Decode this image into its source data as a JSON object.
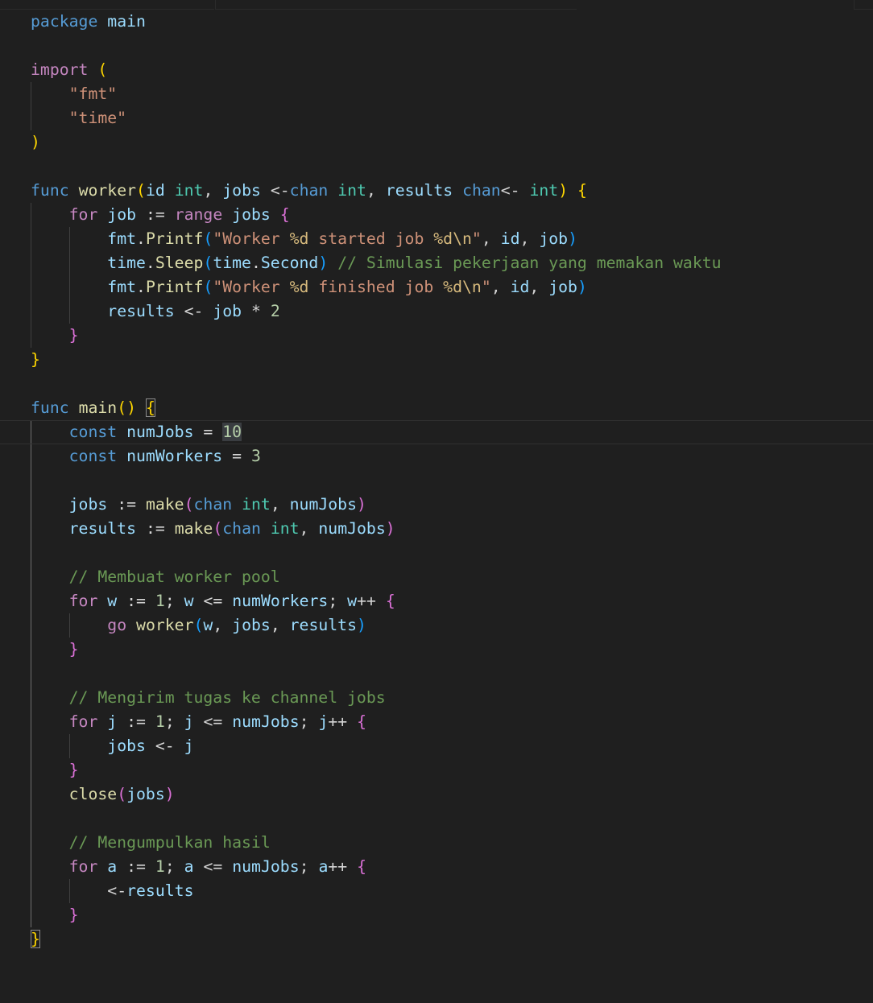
{
  "colors": {
    "background": "#1f1f1f",
    "keyword_blue": "#569cd6",
    "keyword_control": "#c586c0",
    "function": "#dcdcaa",
    "type": "#4ec9b0",
    "variable": "#9cdcfe",
    "string": "#ce9178",
    "escape": "#d7ba7d",
    "number": "#b5cea8",
    "comment": "#6a9955",
    "bracket_gold": "#ffd700",
    "bracket_purple": "#da70d6",
    "bracket_blue": "#179fff",
    "plain": "#d4d4d4"
  },
  "code_lines": [
    [
      [
        "package",
        "kw"
      ],
      [
        " ",
        "p"
      ],
      [
        "main",
        "plain"
      ]
    ],
    [],
    [
      [
        "import",
        "ctl"
      ],
      [
        " ",
        "p"
      ],
      [
        "(",
        "b1"
      ]
    ],
    [
      [
        "    ",
        "p"
      ],
      [
        "\"fmt\"",
        "str"
      ]
    ],
    [
      [
        "    ",
        "p"
      ],
      [
        "\"time\"",
        "str"
      ]
    ],
    [
      [
        ")",
        "b1"
      ]
    ],
    [],
    [
      [
        "func",
        "kw"
      ],
      [
        " ",
        "p"
      ],
      [
        "worker",
        "fn"
      ],
      [
        "(",
        "b1"
      ],
      [
        "id",
        "var"
      ],
      [
        " ",
        "p"
      ],
      [
        "int",
        "type"
      ],
      [
        ", ",
        "p"
      ],
      [
        "jobs",
        "var"
      ],
      [
        " ",
        "p"
      ],
      [
        "<-",
        "op"
      ],
      [
        "chan",
        "kw"
      ],
      [
        " ",
        "p"
      ],
      [
        "int",
        "type"
      ],
      [
        ", ",
        "p"
      ],
      [
        "results",
        "var"
      ],
      [
        " ",
        "p"
      ],
      [
        "chan",
        "kw"
      ],
      [
        "<-",
        "op"
      ],
      [
        " ",
        "p"
      ],
      [
        "int",
        "type"
      ],
      [
        ")",
        "b1"
      ],
      [
        " ",
        "p"
      ],
      [
        "{",
        "b1"
      ]
    ],
    [
      [
        "    ",
        "p"
      ],
      [
        "for",
        "ctl"
      ],
      [
        " ",
        "p"
      ],
      [
        "job",
        "var"
      ],
      [
        " ",
        "p"
      ],
      [
        ":=",
        "op"
      ],
      [
        " ",
        "p"
      ],
      [
        "range",
        "ctl"
      ],
      [
        " ",
        "p"
      ],
      [
        "jobs",
        "var"
      ],
      [
        " ",
        "p"
      ],
      [
        "{",
        "b2"
      ]
    ],
    [
      [
        "        ",
        "p"
      ],
      [
        "fmt",
        "var"
      ],
      [
        ".",
        "p"
      ],
      [
        "Printf",
        "fn"
      ],
      [
        "(",
        "b3"
      ],
      [
        "\"Worker ",
        "str"
      ],
      [
        "%d",
        "esc"
      ],
      [
        " started job ",
        "str"
      ],
      [
        "%d",
        "esc"
      ],
      [
        "\\n",
        "esc"
      ],
      [
        "\"",
        "str"
      ],
      [
        ", ",
        "p"
      ],
      [
        "id",
        "var"
      ],
      [
        ", ",
        "p"
      ],
      [
        "job",
        "var"
      ],
      [
        ")",
        "b3"
      ]
    ],
    [
      [
        "        ",
        "p"
      ],
      [
        "time",
        "var"
      ],
      [
        ".",
        "p"
      ],
      [
        "Sleep",
        "fn"
      ],
      [
        "(",
        "b3"
      ],
      [
        "time",
        "var"
      ],
      [
        ".",
        "p"
      ],
      [
        "Second",
        "var"
      ],
      [
        ")",
        "b3"
      ],
      [
        " ",
        "p"
      ],
      [
        "// Simulasi pekerjaan yang memakan waktu",
        "cmt"
      ]
    ],
    [
      [
        "        ",
        "p"
      ],
      [
        "fmt",
        "var"
      ],
      [
        ".",
        "p"
      ],
      [
        "Printf",
        "fn"
      ],
      [
        "(",
        "b3"
      ],
      [
        "\"Worker ",
        "str"
      ],
      [
        "%d",
        "esc"
      ],
      [
        " finished job ",
        "str"
      ],
      [
        "%d",
        "esc"
      ],
      [
        "\\n",
        "esc"
      ],
      [
        "\"",
        "str"
      ],
      [
        ", ",
        "p"
      ],
      [
        "id",
        "var"
      ],
      [
        ", ",
        "p"
      ],
      [
        "job",
        "var"
      ],
      [
        ")",
        "b3"
      ]
    ],
    [
      [
        "        ",
        "p"
      ],
      [
        "results",
        "var"
      ],
      [
        " ",
        "p"
      ],
      [
        "<-",
        "op"
      ],
      [
        " ",
        "p"
      ],
      [
        "job",
        "var"
      ],
      [
        " ",
        "p"
      ],
      [
        "*",
        "op"
      ],
      [
        " ",
        "p"
      ],
      [
        "2",
        "num"
      ]
    ],
    [
      [
        "    ",
        "p"
      ],
      [
        "}",
        "b2"
      ]
    ],
    [
      [
        "}",
        "b1"
      ]
    ],
    [],
    [
      [
        "func",
        "kw"
      ],
      [
        " ",
        "p"
      ],
      [
        "main",
        "fn"
      ],
      [
        "()",
        "b1"
      ],
      [
        " ",
        "p"
      ],
      [
        "{",
        "b1bm"
      ]
    ],
    [
      [
        "    ",
        "p"
      ],
      [
        "const",
        "kw"
      ],
      [
        " ",
        "p"
      ],
      [
        "numJobs",
        "var"
      ],
      [
        " ",
        "p"
      ],
      [
        "=",
        "op"
      ],
      [
        " ",
        "p"
      ],
      [
        "10",
        "numsel"
      ]
    ],
    [
      [
        "    ",
        "p"
      ],
      [
        "const",
        "kw"
      ],
      [
        " ",
        "p"
      ],
      [
        "numWorkers",
        "var"
      ],
      [
        " ",
        "p"
      ],
      [
        "=",
        "op"
      ],
      [
        " ",
        "p"
      ],
      [
        "3",
        "num"
      ]
    ],
    [],
    [
      [
        "    ",
        "p"
      ],
      [
        "jobs",
        "var"
      ],
      [
        " ",
        "p"
      ],
      [
        ":=",
        "op"
      ],
      [
        " ",
        "p"
      ],
      [
        "make",
        "fn"
      ],
      [
        "(",
        "b2"
      ],
      [
        "chan",
        "kw"
      ],
      [
        " ",
        "p"
      ],
      [
        "int",
        "type"
      ],
      [
        ", ",
        "p"
      ],
      [
        "numJobs",
        "var"
      ],
      [
        ")",
        "b2"
      ]
    ],
    [
      [
        "    ",
        "p"
      ],
      [
        "results",
        "var"
      ],
      [
        " ",
        "p"
      ],
      [
        ":=",
        "op"
      ],
      [
        " ",
        "p"
      ],
      [
        "make",
        "fn"
      ],
      [
        "(",
        "b2"
      ],
      [
        "chan",
        "kw"
      ],
      [
        " ",
        "p"
      ],
      [
        "int",
        "type"
      ],
      [
        ", ",
        "p"
      ],
      [
        "numJobs",
        "var"
      ],
      [
        ")",
        "b2"
      ]
    ],
    [],
    [
      [
        "    ",
        "p"
      ],
      [
        "// Membuat worker pool",
        "cmt"
      ]
    ],
    [
      [
        "    ",
        "p"
      ],
      [
        "for",
        "ctl"
      ],
      [
        " ",
        "p"
      ],
      [
        "w",
        "var"
      ],
      [
        " ",
        "p"
      ],
      [
        ":=",
        "op"
      ],
      [
        " ",
        "p"
      ],
      [
        "1",
        "num"
      ],
      [
        "; ",
        "p"
      ],
      [
        "w",
        "var"
      ],
      [
        " ",
        "p"
      ],
      [
        "<=",
        "op"
      ],
      [
        " ",
        "p"
      ],
      [
        "numWorkers",
        "var"
      ],
      [
        "; ",
        "p"
      ],
      [
        "w",
        "var"
      ],
      [
        "++",
        "op"
      ],
      [
        " ",
        "p"
      ],
      [
        "{",
        "b2"
      ]
    ],
    [
      [
        "        ",
        "p"
      ],
      [
        "go",
        "ctl"
      ],
      [
        " ",
        "p"
      ],
      [
        "worker",
        "fn"
      ],
      [
        "(",
        "b3"
      ],
      [
        "w",
        "var"
      ],
      [
        ", ",
        "p"
      ],
      [
        "jobs",
        "var"
      ],
      [
        ", ",
        "p"
      ],
      [
        "results",
        "var"
      ],
      [
        ")",
        "b3"
      ]
    ],
    [
      [
        "    ",
        "p"
      ],
      [
        "}",
        "b2"
      ]
    ],
    [],
    [
      [
        "    ",
        "p"
      ],
      [
        "// Mengirim tugas ke channel jobs",
        "cmt"
      ]
    ],
    [
      [
        "    ",
        "p"
      ],
      [
        "for",
        "ctl"
      ],
      [
        " ",
        "p"
      ],
      [
        "j",
        "var"
      ],
      [
        " ",
        "p"
      ],
      [
        ":=",
        "op"
      ],
      [
        " ",
        "p"
      ],
      [
        "1",
        "num"
      ],
      [
        "; ",
        "p"
      ],
      [
        "j",
        "var"
      ],
      [
        " ",
        "p"
      ],
      [
        "<=",
        "op"
      ],
      [
        " ",
        "p"
      ],
      [
        "numJobs",
        "var"
      ],
      [
        "; ",
        "p"
      ],
      [
        "j",
        "var"
      ],
      [
        "++",
        "op"
      ],
      [
        " ",
        "p"
      ],
      [
        "{",
        "b2"
      ]
    ],
    [
      [
        "        ",
        "p"
      ],
      [
        "jobs",
        "var"
      ],
      [
        " ",
        "p"
      ],
      [
        "<-",
        "op"
      ],
      [
        " ",
        "p"
      ],
      [
        "j",
        "var"
      ]
    ],
    [
      [
        "    ",
        "p"
      ],
      [
        "}",
        "b2"
      ]
    ],
    [
      [
        "    ",
        "p"
      ],
      [
        "close",
        "fn"
      ],
      [
        "(",
        "b2"
      ],
      [
        "jobs",
        "var"
      ],
      [
        ")",
        "b2"
      ]
    ],
    [],
    [
      [
        "    ",
        "p"
      ],
      [
        "// Mengumpulkan hasil",
        "cmt"
      ]
    ],
    [
      [
        "    ",
        "p"
      ],
      [
        "for",
        "ctl"
      ],
      [
        " ",
        "p"
      ],
      [
        "a",
        "var"
      ],
      [
        " ",
        "p"
      ],
      [
        ":=",
        "op"
      ],
      [
        " ",
        "p"
      ],
      [
        "1",
        "num"
      ],
      [
        "; ",
        "p"
      ],
      [
        "a",
        "var"
      ],
      [
        " ",
        "p"
      ],
      [
        "<=",
        "op"
      ],
      [
        " ",
        "p"
      ],
      [
        "numJobs",
        "var"
      ],
      [
        "; ",
        "p"
      ],
      [
        "a",
        "var"
      ],
      [
        "++",
        "op"
      ],
      [
        " ",
        "p"
      ],
      [
        "{",
        "b2"
      ]
    ],
    [
      [
        "        ",
        "p"
      ],
      [
        "<-",
        "op"
      ],
      [
        "results",
        "var"
      ]
    ],
    [
      [
        "    ",
        "p"
      ],
      [
        "}",
        "b2"
      ]
    ],
    [
      [
        "}",
        "b1bm"
      ]
    ]
  ],
  "current_line": 17
}
